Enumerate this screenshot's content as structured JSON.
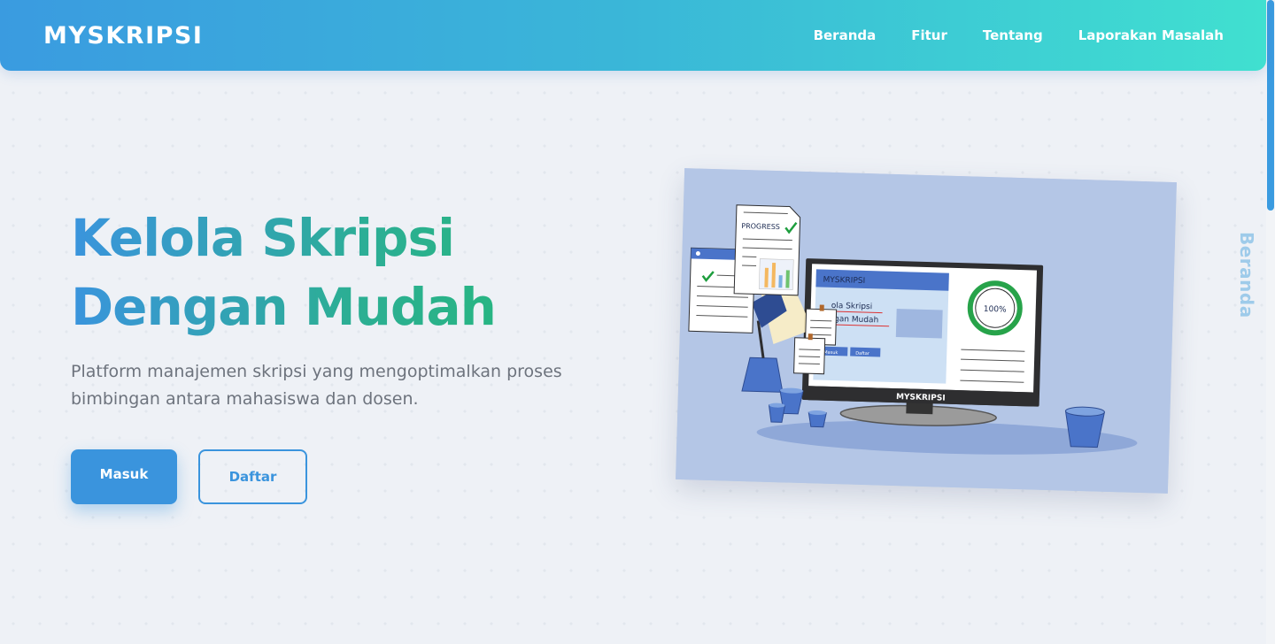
{
  "navbar": {
    "brand": "MYSKRIPSI",
    "links": [
      "Beranda",
      "Fitur",
      "Tentang",
      "Laporakan Masalah"
    ]
  },
  "side_label": "Beranda",
  "hero": {
    "title_line1": "Kelola Skripsi",
    "title_line2": "Dengan Mudah",
    "description": "Platform manajemen skripsi yang mengoptimalkan proses bimbingan antara mahasiswa dan dosen.",
    "primary_button": "Masuk",
    "secondary_button": "Daftar"
  },
  "illustration": {
    "progress_label": "PROGRESS",
    "screen_brand": "MYSKRIPSI",
    "screen_title_line1": "ola Skripsi",
    "screen_title_line2": "ngan Mudah",
    "screen_btn1": "Masuk",
    "screen_btn2": "Daftar",
    "percent": "100%",
    "stand_label": "MYSKRIPSI"
  },
  "colors": {
    "primary": "#3a94dd",
    "navbar_gradient_start": "#3a9be0",
    "navbar_gradient_end": "#40e0d0",
    "title_gradient_end": "#26b87a"
  }
}
